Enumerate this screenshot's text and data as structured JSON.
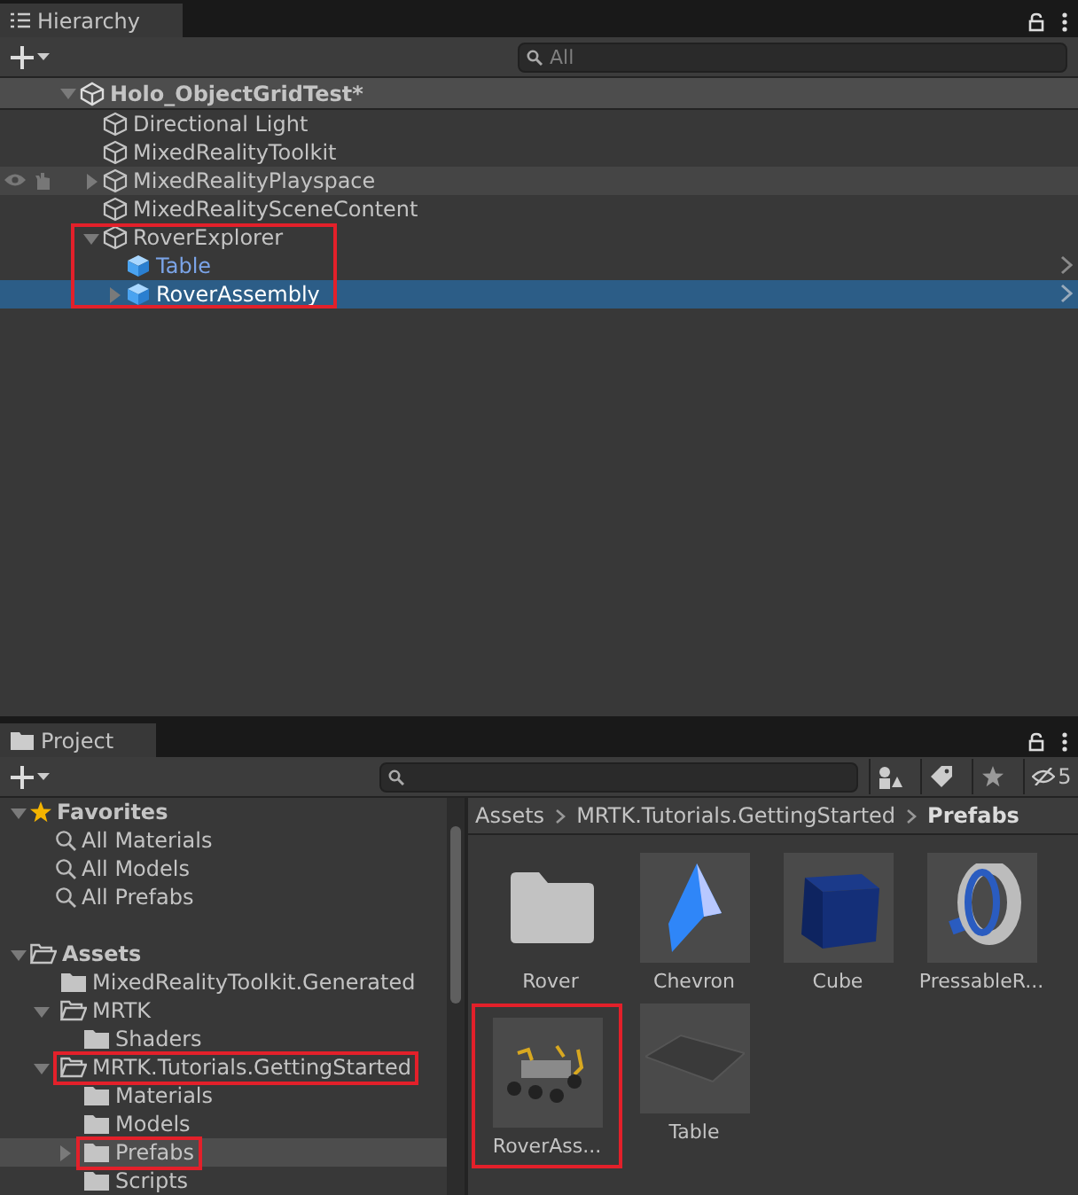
{
  "hierarchy": {
    "tab": "Hierarchy",
    "search": {
      "placeholder": "All"
    },
    "scene": {
      "name": "Holo_ObjectGridTest*",
      "expanded": true,
      "children": [
        {
          "name": "Directional Light",
          "kind": "gameobject",
          "selected": false,
          "hovered": false
        },
        {
          "name": "MixedRealityToolkit",
          "kind": "gameobject",
          "selected": false,
          "hovered": false
        },
        {
          "name": "MixedRealityPlayspace",
          "kind": "gameobject",
          "expanded": false,
          "selected": false,
          "hovered": true
        },
        {
          "name": "MixedRealitySceneContent",
          "kind": "gameobject",
          "selected": false,
          "hovered": false
        },
        {
          "name": "RoverExplorer",
          "kind": "gameobject",
          "expanded": true,
          "selected": false,
          "hovered": false,
          "highlighted": true,
          "children": [
            {
              "name": "Table",
              "kind": "prefab",
              "selected": false,
              "hovered": false
            },
            {
              "name": "RoverAssembly",
              "kind": "prefab",
              "expanded": false,
              "selected": true,
              "hovered": false
            }
          ]
        }
      ]
    }
  },
  "project": {
    "tab": "Project",
    "hidden_count": "5",
    "favorites": {
      "label": "Favorites",
      "expanded": true,
      "items": [
        "All Materials",
        "All Models",
        "All Prefabs"
      ]
    },
    "assets": {
      "label": "Assets",
      "expanded": true,
      "children": [
        {
          "name": "MixedRealityToolkit.Generated",
          "selected": false,
          "highlighted": false
        },
        {
          "name": "MRTK",
          "expanded": true,
          "selected": false,
          "highlighted": false,
          "children": [
            {
              "name": "Shaders",
              "selected": false,
              "highlighted": false
            }
          ]
        },
        {
          "name": "MRTK.Tutorials.GettingStarted",
          "expanded": true,
          "selected": false,
          "highlighted": true,
          "children": [
            {
              "name": "Materials",
              "selected": false,
              "highlighted": false
            },
            {
              "name": "Models",
              "selected": false,
              "highlighted": false
            },
            {
              "name": "Prefabs",
              "expanded": false,
              "selected": true,
              "highlighted": true
            },
            {
              "name": "Scripts",
              "selected": false,
              "highlighted": false
            }
          ]
        }
      ]
    },
    "breadcrumb": [
      "Assets",
      "MRTK.Tutorials.GettingStarted",
      "Prefabs"
    ],
    "items": [
      {
        "name": "Rover",
        "kind": "folder",
        "highlighted": false
      },
      {
        "name": "Chevron",
        "kind": "chevron",
        "highlighted": false
      },
      {
        "name": "Cube",
        "kind": "cube",
        "highlighted": false
      },
      {
        "name": "PressableR...",
        "kind": "ring",
        "highlighted": false
      },
      {
        "name": "RoverAss...",
        "kind": "rover",
        "highlighted": true
      },
      {
        "name": "Table",
        "kind": "plane",
        "highlighted": false
      }
    ]
  }
}
